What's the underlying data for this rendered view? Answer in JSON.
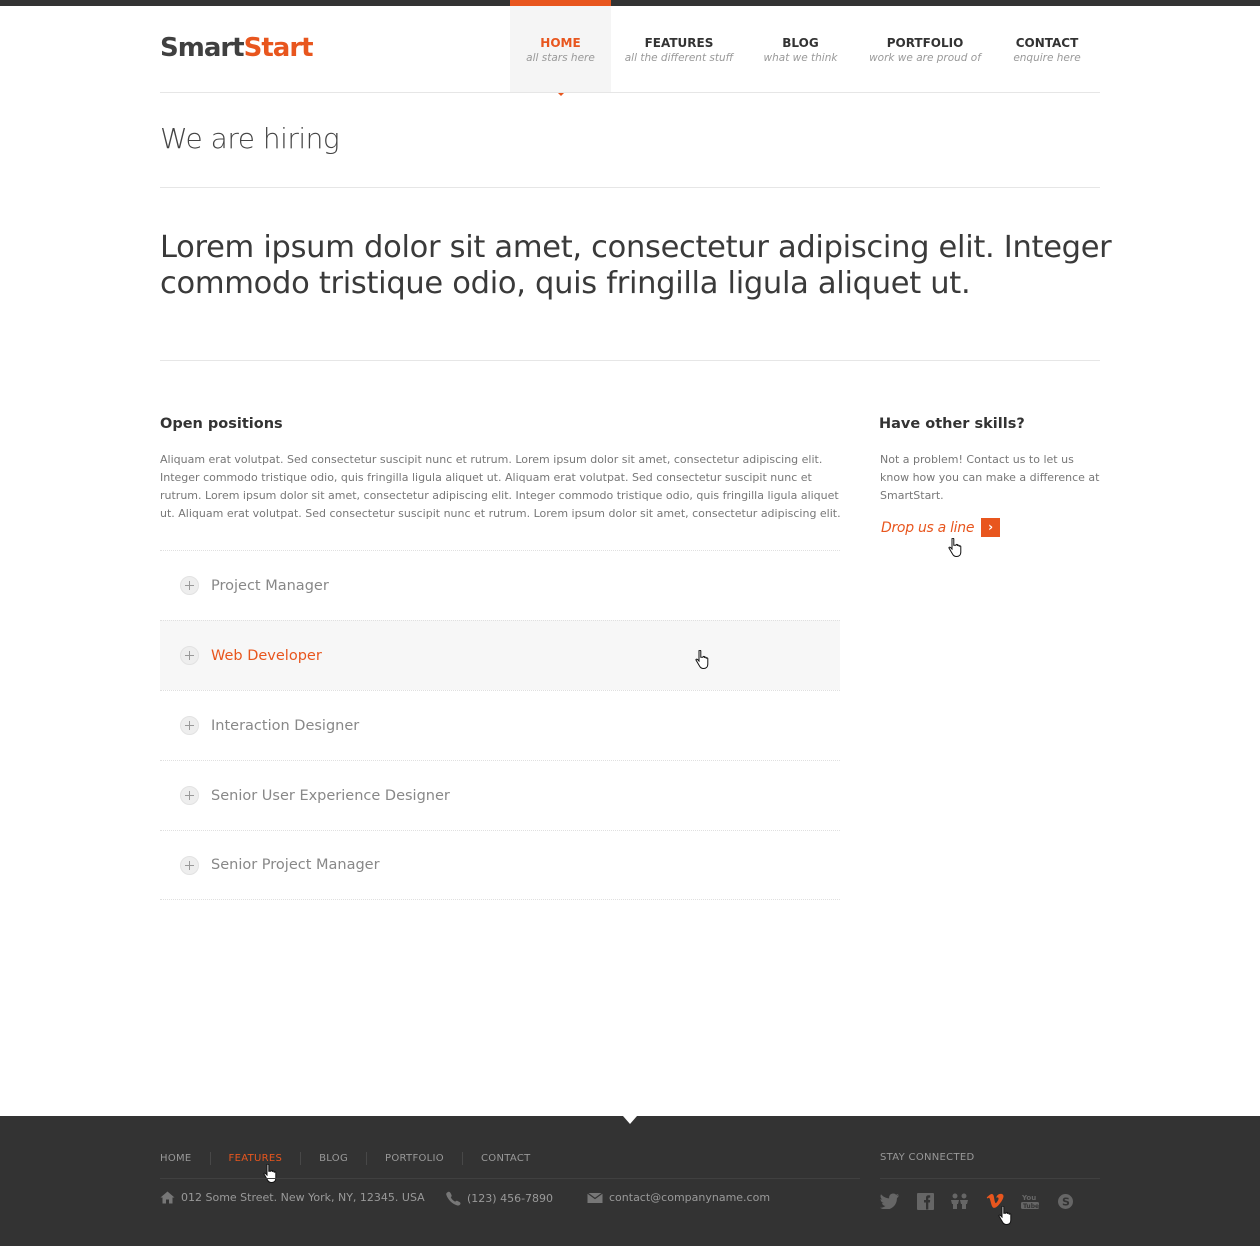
{
  "brand": {
    "name_part1": "Smart",
    "name_part2": "Start",
    "accent_color": "#e8561e"
  },
  "nav": [
    {
      "label": "HOME",
      "sub": "all stars here",
      "active": true
    },
    {
      "label": "FEATURES",
      "sub": "all the different stuff",
      "active": false
    },
    {
      "label": "BLOG",
      "sub": "what we think",
      "active": false
    },
    {
      "label": "PORTFOLIO",
      "sub": "work we are proud of",
      "active": false
    },
    {
      "label": "CONTACT",
      "sub": "enquire here",
      "active": false
    }
  ],
  "page": {
    "title": "We are hiring",
    "lead": "Lorem ipsum dolor sit amet, consectetur adipiscing elit. Integer commodo tristique odio, quis fringilla ligula aliquet ut."
  },
  "positions": {
    "heading": "Open positions",
    "text": "Aliquam erat volutpat. Sed consectetur suscipit nunc et rutrum. Lorem ipsum dolor sit amet, consectetur adipiscing elit. Integer commodo tristique odio, quis fringilla ligula aliquet ut. Aliquam erat volutpat. Sed consectetur suscipit nunc et rutrum. Lorem ipsum dolor sit amet, consectetur adipiscing elit. Integer commodo tristique odio, quis fringilla ligula aliquet ut. Aliquam erat volutpat. Sed consectetur suscipit nunc et rutrum. Lorem ipsum dolor sit amet, consectetur adipiscing elit.",
    "items": [
      {
        "label": "Project Manager",
        "hover": false
      },
      {
        "label": "Web Developer",
        "hover": true
      },
      {
        "label": "Interaction Designer",
        "hover": false
      },
      {
        "label": "Senior User Experience Designer",
        "hover": false
      },
      {
        "label": "Senior Project Manager",
        "hover": false
      }
    ]
  },
  "sidebar": {
    "heading": "Have other skills?",
    "text": "Not a problem! Contact us to let us know how you can make a difference at SmartStart.",
    "cta": "Drop us a line",
    "cta_icon": "chevron-right-icon"
  },
  "footer": {
    "nav": [
      {
        "label": "HOME",
        "active": false
      },
      {
        "label": "FEATURES",
        "active": true
      },
      {
        "label": "BLOG",
        "active": false
      },
      {
        "label": "PORTFOLIO",
        "active": false
      },
      {
        "label": "CONTACT",
        "active": false
      }
    ],
    "address": "012 Some Street. New York, NY, 12345. USA",
    "phone": "(123) 456-7890",
    "email": "contact@companyname.com",
    "stay_connected": "STAY CONNECTED",
    "social": [
      "twitter-icon",
      "facebook-icon",
      "people-icon",
      "vimeo-icon",
      "youtube-icon",
      "skype-icon"
    ],
    "active_social": "vimeo-icon"
  }
}
